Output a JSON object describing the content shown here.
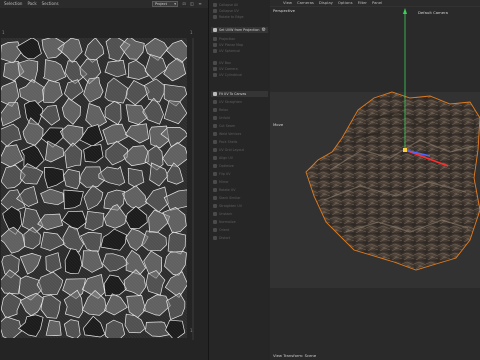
{
  "uv_editor": {
    "menu": [
      "Selection",
      "Pack",
      "Sections"
    ],
    "project_dropdown": "Project",
    "zoom_icons": [
      "zoom-fit-icon",
      "lock-icon"
    ],
    "corner_marks": {
      "top_left": "1",
      "top_right": "1",
      "bottom_right": "1"
    }
  },
  "side_panel": {
    "top_items": [
      "Collapse All",
      "Collapse UV",
      "Rotate to Edge",
      "Create Cut",
      "Sew Selected",
      "UV Shell",
      "UV Crop"
    ],
    "projection_item": "Set UVW from Projection",
    "projection_subitems": [
      "Projection",
      "UV Planar Map",
      "UV Spherical",
      "UV Box",
      "UV Camera",
      "UV Cylindrical"
    ],
    "fit_item": "Fit UV To Canvas",
    "fit_subitems": [
      "UV Straighten",
      "Relax",
      "Unfold",
      "Cut Seam",
      "Weld Vertices",
      "Pack Shells",
      "UV Grid Layout",
      "Align UV",
      "Optimize",
      "Flip UV",
      "Mirror",
      "Rotate UV",
      "Stack Similar",
      "Straighten UV",
      "Unstack",
      "Normalize",
      "Orient",
      "Distort"
    ],
    "projection_gear_icon": "gear-icon"
  },
  "viewport": {
    "menu": [
      "View",
      "Cameras",
      "Display",
      "Options",
      "Filter",
      "Panel"
    ],
    "camera_label": "Perspective",
    "default_camera_label": "Default Camera",
    "axis_label": "Move",
    "status_text": "View Transform: Scene",
    "colors": {
      "selection_outline": "#e07b1f",
      "gizmo_green": "#3ad35a",
      "gizmo_blue": "#4a6aff",
      "gizmo_red": "#ff2d2d"
    }
  }
}
